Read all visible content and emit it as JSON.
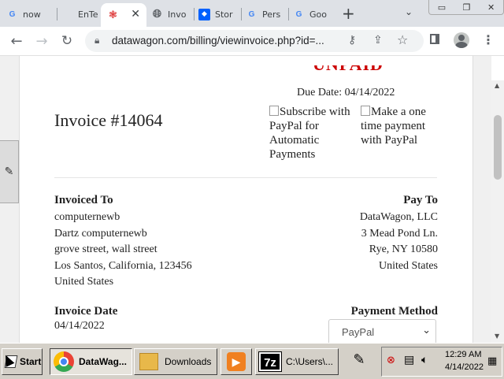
{
  "browser": {
    "tabs": [
      {
        "label": "now"
      },
      {
        "label": "EnTe"
      },
      {
        "label": ""
      },
      {
        "label": "Invo"
      },
      {
        "label": "Stor"
      },
      {
        "label": "Pers"
      },
      {
        "label": "Goo"
      }
    ],
    "url": "datawagon.com/billing/viewinvoice.php?id=..."
  },
  "invoice": {
    "status_partial": "UNPAID",
    "due_date": "Due Date: 04/14/2022",
    "title": "Invoice #14064",
    "paypal_subscribe": "Subscribe with PayPal for Automatic Payments",
    "paypal_onetime": "Make a one time payment with PayPal",
    "invoiced_to": {
      "heading": "Invoiced To",
      "lines": [
        "computernewb",
        "Dartz computernewb",
        "grove street, wall street",
        "Los Santos, California, 123456",
        "United States"
      ]
    },
    "pay_to": {
      "heading": "Pay To",
      "lines": [
        "DataWagon, LLC",
        "3 Mead Pond Ln.",
        "Rye, NY 10580",
        "United States"
      ]
    },
    "invoice_date": {
      "heading": "Invoice Date",
      "value": "04/14/2022"
    },
    "payment_method": {
      "heading": "Payment Method",
      "selected": "PayPal"
    }
  },
  "taskbar": {
    "start": "Start",
    "buttons": [
      {
        "label": "DataWag..."
      },
      {
        "label": "Downloads"
      },
      {
        "label": ""
      },
      {
        "label": "C:\\Users\\..."
      }
    ],
    "time": "12:29 AM",
    "date": "4/14/2022"
  }
}
